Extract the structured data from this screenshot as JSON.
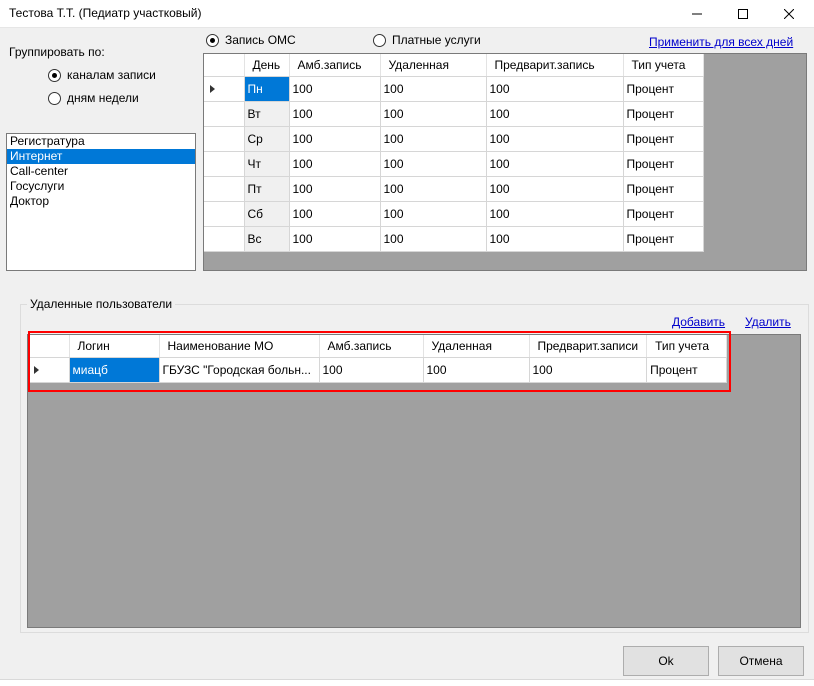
{
  "window": {
    "title": "Тестова Т.Т. (Педиатр участковый)"
  },
  "group_by": {
    "label": "Группировать по:",
    "options": [
      {
        "label": "каналам записи",
        "checked": true
      },
      {
        "label": "дням недели",
        "checked": false
      }
    ]
  },
  "mode": {
    "oms_label": "Запись ОМС",
    "paid_label": "Платные услуги",
    "apply_all_link": "Применить для всех дней"
  },
  "channels": [
    "Регистратура",
    "Интернет",
    "Call-center",
    "Госуслуги",
    "Доктор"
  ],
  "schedule_grid": {
    "columns": [
      "День",
      "Амб.запись",
      "Удаленная",
      "Предварит.запись",
      "Тип учета"
    ],
    "rows": [
      [
        "Пн",
        "100",
        "100",
        "100",
        "Процент"
      ],
      [
        "Вт",
        "100",
        "100",
        "100",
        "Процент"
      ],
      [
        "Ср",
        "100",
        "100",
        "100",
        "Процент"
      ],
      [
        "Чт",
        "100",
        "100",
        "100",
        "Процент"
      ],
      [
        "Пт",
        "100",
        "100",
        "100",
        "Процент"
      ],
      [
        "Сб",
        "100",
        "100",
        "100",
        "Процент"
      ],
      [
        "Вс",
        "100",
        "100",
        "100",
        "Процент"
      ]
    ]
  },
  "remote_users": {
    "group_label": "Удаленные пользователи",
    "add_link": "Добавить",
    "delete_link": "Удалить",
    "columns": [
      "Логин",
      "Наименование МО",
      "Амб.запись",
      "Удаленная",
      "Предварит.записи",
      "Тип учета"
    ],
    "rows": [
      [
        "миацб",
        "ГБУЗС \"Городская больн...",
        "100",
        "100",
        "100",
        "Процент"
      ]
    ]
  },
  "buttons": {
    "ok": "Ok",
    "cancel": "Отмена"
  }
}
